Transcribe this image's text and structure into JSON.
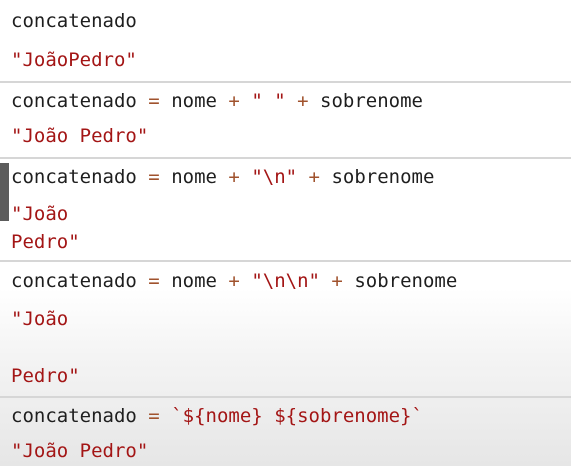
{
  "entries": [
    {
      "input": {
        "var": "concatenado"
      },
      "output": "\"JoãoPedro\""
    },
    {
      "input": {
        "var": "concatenado",
        "eq": "=",
        "lhs": "nome",
        "plus1": "+",
        "str": "\" \"",
        "plus2": "+",
        "rhs": "sobrenome"
      },
      "output": "\"João Pedro\""
    },
    {
      "input": {
        "var": "concatenado",
        "eq": "=",
        "lhs": "nome",
        "plus1": "+",
        "str": "\"\\n\"",
        "plus2": "+",
        "rhs": "sobrenome"
      },
      "output_line1": "\"João",
      "output_line2": "Pedro\""
    },
    {
      "input": {
        "var": "concatenado",
        "eq": "=",
        "lhs": "nome",
        "plus1": "+",
        "str": "\"\\n\\n\"",
        "plus2": "+",
        "rhs": "sobrenome"
      },
      "output_line1": "\"João",
      "output_line2": "Pedro\""
    },
    {
      "input": {
        "var": "concatenado",
        "eq": "=",
        "tick_open": "`",
        "expr1": "${nome}",
        "space": " ",
        "expr2": "${sobrenome}",
        "tick_close": "`"
      },
      "output": "\"João Pedro\""
    }
  ]
}
